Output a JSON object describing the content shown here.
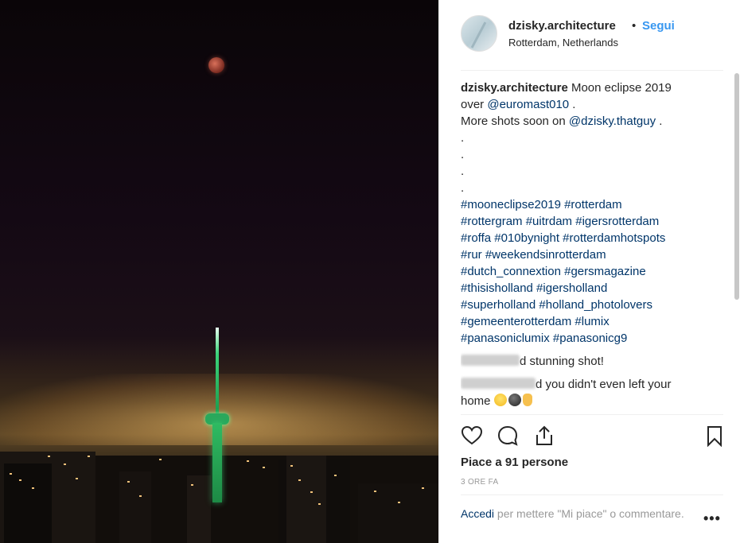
{
  "header": {
    "username": "dzisky.architecture",
    "separator": "•",
    "follow_label": "Segui",
    "location": "Rotterdam, Netherlands"
  },
  "caption": {
    "username": "dzisky.architecture",
    "text_1": " Moon eclipse 2019",
    "line_2_prefix": "over ",
    "mention_1": "@euromast010",
    "line_2_suffix": " .",
    "line_3_prefix": "More shots soon on ",
    "mention_2": "@dzisky.thatguy",
    "line_3_suffix": " .",
    "dots": [
      ".",
      ".",
      ".",
      "."
    ],
    "hashtag_lines": [
      "#mooneclipse2019 #rotterdam",
      "#rottergram #uitrdam #igersrotterdam",
      "#roffa #010bynight #rotterdamhotspots",
      "#rur #weekendsinrotterdam",
      "#dutch_connextion #gersmagazine",
      "#thisisholland #igersholland",
      "#superholland #holland_photolovers",
      "#gemeenterotterdam #lumix",
      "#panasoniclumix #panasonicg9"
    ]
  },
  "comments": [
    {
      "text": "d stunning shot!"
    },
    {
      "text_1": "d you didn't even left your",
      "text_2": "home "
    }
  ],
  "actions": {
    "icons": [
      "heart-icon",
      "comment-icon",
      "share-icon",
      "bookmark-icon"
    ]
  },
  "likes": "Piace a 91 persone",
  "time": "3 ORE FA",
  "login": {
    "link": "Accedi",
    "text": " per mettere \"Mi piace\" o commentare."
  },
  "more": "•••",
  "colors": {
    "link": "#003569",
    "follow": "#3897f0",
    "muted": "#999999"
  }
}
